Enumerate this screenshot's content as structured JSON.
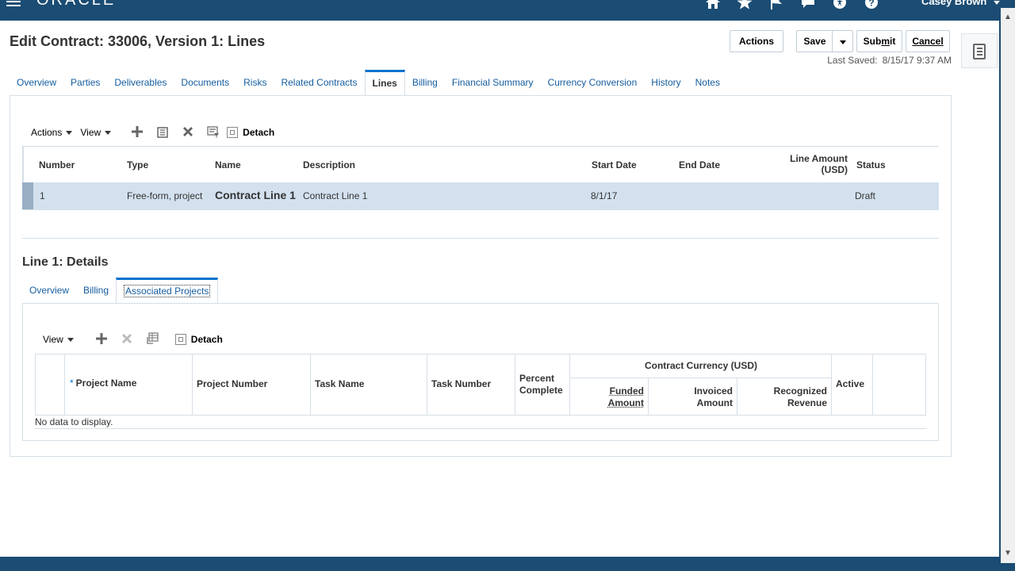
{
  "header": {
    "logo": "ORACLE",
    "user_name": "Casey Brown",
    "icons": [
      "home-icon",
      "star-icon",
      "flag-icon",
      "chat-icon",
      "accessibility-icon",
      "help-icon"
    ]
  },
  "page": {
    "title": "Edit Contract: 33006, Version 1: Lines",
    "actions_label": "Actions",
    "save_label": "Save",
    "submit_label_pre": "Sub",
    "submit_label_u": "m",
    "submit_label_post": "it",
    "cancel_label_u": "C",
    "cancel_label_post": "ancel",
    "last_saved_label": "Last Saved:",
    "last_saved_value": "8/15/17 9:37 AM"
  },
  "tabs": [
    "Overview",
    "Parties",
    "Deliverables",
    "Documents",
    "Risks",
    "Related Contracts",
    "Lines",
    "Billing",
    "Financial Summary",
    "Currency Conversion",
    "History",
    "Notes"
  ],
  "lines_toolbar": {
    "actions_label": "Actions",
    "view_label": "View",
    "detach_label": "Detach"
  },
  "lines_table": {
    "headers": {
      "number": "Number",
      "type": "Type",
      "name": "Name",
      "description": "Description",
      "start_date": "Start Date",
      "end_date": "End Date",
      "line_amount_1": "Line Amount",
      "line_amount_2": "(USD)",
      "status": "Status"
    },
    "row": {
      "number": "1",
      "type": "Free-form, project",
      "name": "Contract Line 1",
      "description": "Contract Line 1",
      "start_date": "8/1/17",
      "end_date": "",
      "line_amount": "",
      "status": "Draft"
    }
  },
  "details": {
    "title": "Line 1: Details",
    "subtabs": [
      "Overview",
      "Billing",
      "Associated Projects"
    ],
    "toolbar": {
      "view_label": "View",
      "detach_label": "Detach"
    },
    "table": {
      "required_mark": "*",
      "project_name": "Project Name",
      "project_number": "Project Number",
      "task_name": "Task Name",
      "task_number": "Task Number",
      "percent_1": "Percent",
      "percent_2": "Complete",
      "contract_currency": "Contract Currency (USD)",
      "funded_1": "Funded",
      "funded_2": "Amount",
      "invoiced_1": "Invoiced",
      "invoiced_2": "Amount",
      "recognized_1": "Recognized",
      "recognized_2": "Revenue",
      "active": "Active",
      "empty_text": "No data to display."
    }
  }
}
